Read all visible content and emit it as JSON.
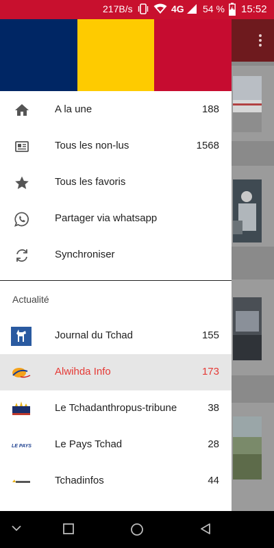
{
  "status_bar": {
    "speed": "217B/s",
    "network": "4G",
    "battery": "54 %",
    "time": "15:52",
    "icons": [
      "vibrate-icon",
      "wifi-icon",
      "signal-icon",
      "battery-charging-icon"
    ]
  },
  "colors": {
    "status_bar": "#c8102e",
    "flag_blue": "#002664",
    "flag_yellow": "#fecb00",
    "flag_red": "#c60c30",
    "selected_text": "#e53935",
    "selected_bg": "#e6e6e6"
  },
  "drawer": {
    "header_image": "flag-of-chad",
    "items": [
      {
        "label": "A la une",
        "count": "188",
        "icon": "home-icon"
      },
      {
        "label": "Tous les non-lus",
        "count": "1568",
        "icon": "newspaper-icon"
      },
      {
        "label": "Tous les favoris",
        "count": "",
        "icon": "star-icon"
      },
      {
        "label": "Partager via whatsapp",
        "count": "",
        "icon": "whatsapp-icon"
      },
      {
        "label": "Synchroniser",
        "count": "",
        "icon": "sync-icon"
      }
    ],
    "section_title": "Actualité",
    "feeds": [
      {
        "label": "Journal du Tchad",
        "count": "155",
        "selected": false
      },
      {
        "label": "Alwihda Info",
        "count": "173",
        "selected": true
      },
      {
        "label": "Le Tchadanthropus-tribune",
        "count": "38",
        "selected": false
      },
      {
        "label": "Le Pays Tchad",
        "count": "28",
        "selected": false
      },
      {
        "label": "Tchadinfos",
        "count": "44",
        "selected": false
      }
    ]
  },
  "nav_bar": {
    "buttons": [
      "collapse-icon",
      "recents-icon",
      "home-icon",
      "back-icon"
    ]
  }
}
